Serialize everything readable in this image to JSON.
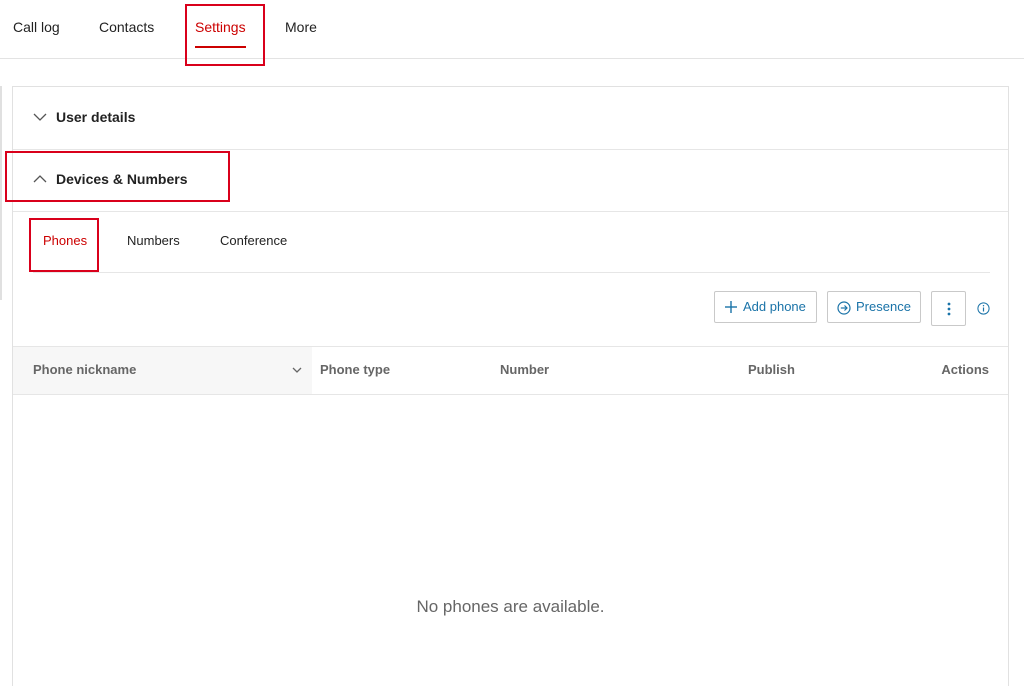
{
  "nav": {
    "tabs": [
      {
        "label": "Call log"
      },
      {
        "label": "Contacts"
      },
      {
        "label": "Settings",
        "active": true
      },
      {
        "label": "More"
      }
    ]
  },
  "settings": {
    "sections": {
      "user_details": {
        "label": "User details",
        "expanded": false
      },
      "devices_numbers": {
        "label": "Devices & Numbers",
        "expanded": true
      }
    },
    "subtabs": [
      {
        "label": "Phones",
        "active": true
      },
      {
        "label": "Numbers"
      },
      {
        "label": "Conference"
      }
    ],
    "toolbar": {
      "add_phone_label": "Add phone",
      "presence_label": "Presence",
      "more_icon": "vertical-dots-icon",
      "info_icon": "info-icon"
    },
    "table": {
      "columns": [
        "Phone nickname",
        "Phone type",
        "Number",
        "Publish",
        "Actions"
      ],
      "rows": [],
      "empty_message": "No phones are available."
    }
  },
  "colors": {
    "accent": "#cc0000",
    "link": "#1a73a8",
    "highlight_box": "#d9001b"
  }
}
